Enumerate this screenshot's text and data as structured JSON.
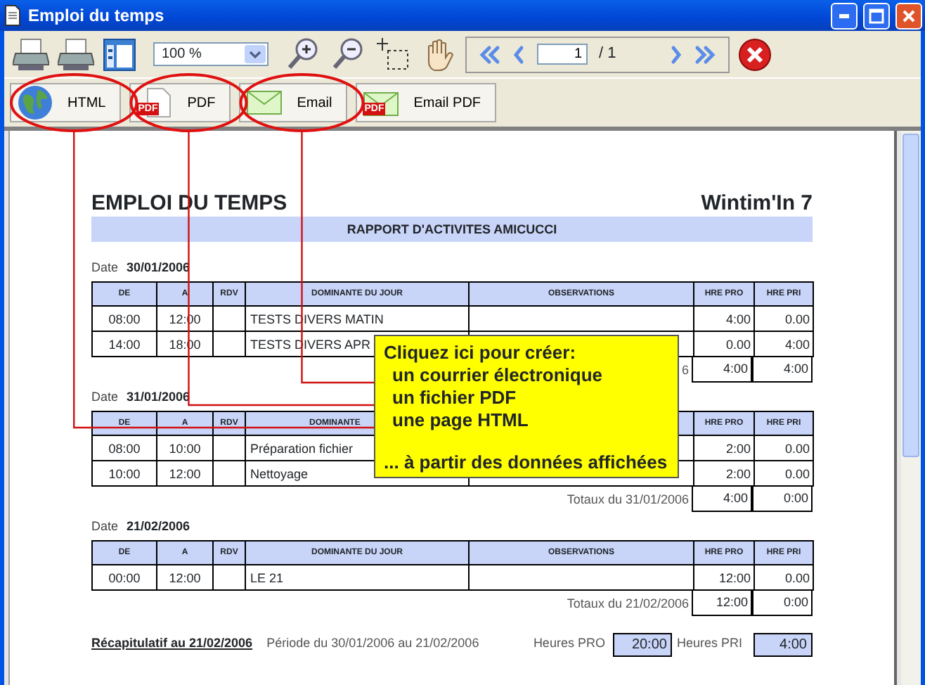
{
  "window": {
    "title": "Emploi du temps"
  },
  "toolbar": {
    "zoom": "100 %",
    "page": "1",
    "page_total": "/ 1"
  },
  "export_buttons": [
    {
      "label": "HTML",
      "kind": "globe",
      "highlighted": true
    },
    {
      "label": "PDF",
      "kind": "pdf",
      "icon_text": "PDF",
      "highlighted": true
    },
    {
      "label": "Email",
      "kind": "mail",
      "highlighted": true
    },
    {
      "label": "Email PDF",
      "kind": "mailpdf",
      "icon_text": "PDF",
      "highlighted": false
    }
  ],
  "report": {
    "title": "EMPLOI DU TEMPS",
    "brand": "Wintim'In 7",
    "subtitle": "RAPPORT D'ACTIVITES AMICUCCI",
    "days": [
      {
        "date_label": "Date",
        "date": "30/01/2006",
        "columns": [
          "DE",
          "A",
          "RDV",
          "DOMINANTE DU JOUR",
          "OBSERVATIONS",
          "HRE PRO",
          "HRE PRI"
        ],
        "rows": [
          [
            "08:00",
            "12:00",
            null,
            "TESTS DIVERS MATIN",
            null,
            "4:00",
            "0.00"
          ],
          [
            "14:00",
            "18:00",
            null,
            "TESTS DIVERS APR",
            null,
            "0.00",
            "4:00"
          ]
        ],
        "totals_label": "6",
        "totals": [
          "4:00",
          "4:00"
        ]
      },
      {
        "date_label": "Date",
        "date": "31/01/2006",
        "columns": [
          "DE",
          "A",
          "RDV",
          "DOMINANTE",
          null,
          "HRE PRO",
          "HRE PRI"
        ],
        "rows": [
          [
            "08:00",
            "10:00",
            null,
            "Préparation fichier",
            null,
            "2:00",
            "0.00"
          ],
          [
            "10:00",
            "12:00",
            null,
            "Nettoyage",
            null,
            "2:00",
            "0.00"
          ]
        ],
        "totals_label": "Totaux du 31/01/2006",
        "totals": [
          "4:00",
          "0:00"
        ]
      },
      {
        "date_label": "Date",
        "date": "21/02/2006",
        "columns": [
          "DE",
          "A",
          "RDV",
          "DOMINANTE DU JOUR",
          "OBSERVATIONS",
          "HRE PRO",
          "HRE PRI"
        ],
        "rows": [
          [
            "00:00",
            "12:00",
            null,
            "LE 21",
            null,
            "12:00",
            "0.00"
          ]
        ],
        "totals_label": "Totaux du 21/02/2006",
        "totals": [
          "12:00",
          "0:00"
        ]
      }
    ],
    "summary": {
      "title": "Récapitulatif au 21/02/2006",
      "period": "Période du 30/01/2006 au 21/02/2006",
      "pro_label": "Heures PRO",
      "pro": "20:00",
      "pri_label": "Heures PRI",
      "pri": "4:00"
    }
  },
  "callout": {
    "heading": "Cliquez ici pour créer:",
    "lines": [
      "un courrier électronique",
      "un fichier PDF",
      "une page HTML"
    ],
    "footer": "... à partir des données affichées"
  }
}
